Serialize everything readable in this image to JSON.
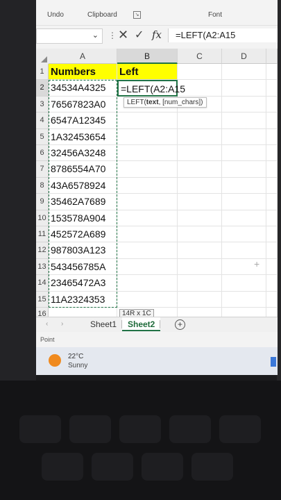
{
  "ribbon": {
    "undo": "Undo",
    "clipboard": "Clipboard",
    "font": "Font"
  },
  "formula_bar": {
    "name_box": "",
    "formula": "=LEFT(A2:A15"
  },
  "columns": [
    "A",
    "B",
    "C",
    "D"
  ],
  "rows": [
    "1",
    "2",
    "3",
    "4",
    "5",
    "6",
    "7",
    "8",
    "9",
    "10",
    "11",
    "12",
    "13",
    "14",
    "15",
    "16"
  ],
  "headers": {
    "a1": "Numbers",
    "b1": "Left"
  },
  "values": [
    "34534A4325",
    "76567823A0",
    "6547A12345",
    "1A32453654",
    "32456A3248",
    "8786554A70",
    "43A6578924",
    "35462A7689",
    "153578A904",
    "452572A689",
    "987803A123",
    "543456785A",
    "23465472A3",
    "11A2324353"
  ],
  "active_cell_text": "=LEFT(A2:A15",
  "tooltip": {
    "fn": "LEFT(",
    "arg_bold": "text",
    "rest": ", [num_chars])"
  },
  "selection_size": "14R x 1C",
  "sheets": {
    "sheet1": "Sheet1",
    "sheet2": "Sheet2",
    "add": "+"
  },
  "status": "Point",
  "weather": {
    "temp": "22°C",
    "cond": "Sunny"
  },
  "colors": {
    "accent": "#217346",
    "header_fill": "#ffff00"
  }
}
